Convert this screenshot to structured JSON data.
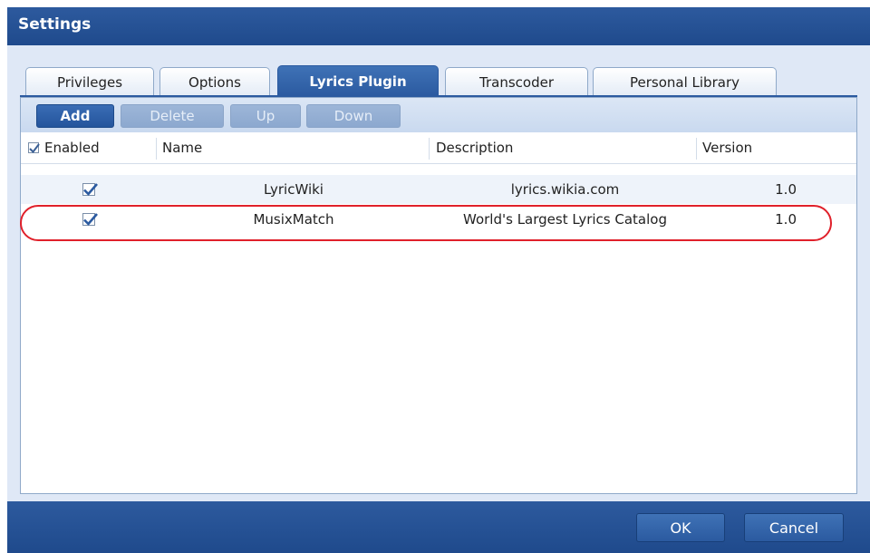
{
  "dialog": {
    "title": "Settings"
  },
  "tabs": [
    {
      "label": "Privileges",
      "active": false
    },
    {
      "label": "Options",
      "active": false
    },
    {
      "label": "Lyrics Plugin",
      "active": true
    },
    {
      "label": "Transcoder",
      "active": false
    },
    {
      "label": "Personal Library",
      "active": false
    }
  ],
  "toolbar": {
    "add": "Add",
    "delete": "Delete",
    "up": "Up",
    "down": "Down"
  },
  "table": {
    "headers": {
      "enabled": "Enabled",
      "name": "Name",
      "description": "Description",
      "version": "Version"
    },
    "rows": [
      {
        "enabled": true,
        "name": "LyricWiki",
        "description": "lyrics.wikia.com",
        "version": "1.0"
      },
      {
        "enabled": true,
        "name": "MusixMatch",
        "description": "World's Largest Lyrics Catalog",
        "version": "1.0"
      }
    ]
  },
  "footer": {
    "ok": "OK",
    "cancel": "Cancel"
  },
  "colors": {
    "accent": "#2b5aa0",
    "highlight_ring": "#e0202a",
    "check": "#2b5aa0"
  }
}
